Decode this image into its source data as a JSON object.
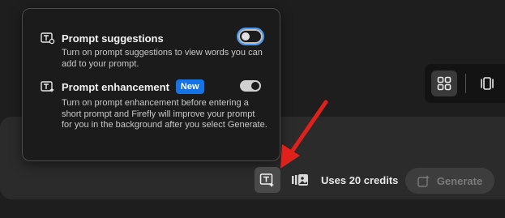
{
  "popover": {
    "suggestions": {
      "title": "Prompt suggestions",
      "description": "Turn on prompt suggestions to view words you can add to your prompt.",
      "enabled": false
    },
    "enhancement": {
      "title": "Prompt enhancement",
      "badge": "New",
      "description": "Turn on prompt enhancement before entering a short prompt and Firefly will improve your prompt for you in the background after you select Generate.",
      "enabled": true
    }
  },
  "footer": {
    "credits_text": "Uses 20 credits",
    "generate_label": "Generate"
  },
  "colors": {
    "accent": "#1473e6",
    "annotation_arrow": "#e0201b",
    "focus": "#4b9cf5"
  }
}
